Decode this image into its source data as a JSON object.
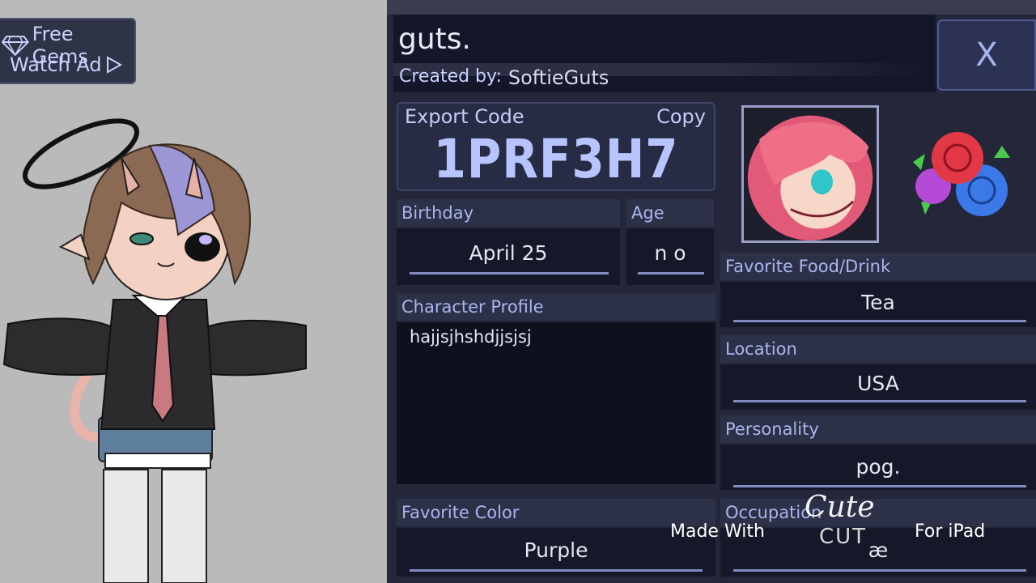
{
  "ad": {
    "free_gems": "Free Gems",
    "watch_ad": "Watch Ad"
  },
  "profile": {
    "name": "guts.",
    "created_by_label": "Created by:",
    "creator": "SoftieGuts",
    "close": "X",
    "export_label": "Export Code",
    "copy_label": "Copy",
    "export_code": "1PRF3H7",
    "birthday_label": "Birthday",
    "birthday": "April 25",
    "age_label": "Age",
    "age": "n o",
    "character_profile_label": "Character Profile",
    "character_profile": "hajjsjhshdjjsjsj",
    "favorite_color_label": "Favorite Color",
    "favorite_color": "Purple",
    "favorite_food_label": "Favorite Food/Drink",
    "favorite_food": "Tea",
    "location_label": "Location",
    "location": "USA",
    "personality_label": "Personality",
    "personality": "pog.",
    "occupation_label": "Occupation",
    "occupation": "æ"
  },
  "watermark": {
    "made_with": "Made With",
    "cute": "Cute",
    "cut": "CUT",
    "for_ipad": "For iPad"
  },
  "colors": {
    "panel_bg": "#232739",
    "header_bg": "#2d3147",
    "accent_text": "#a9b6f0",
    "stage_bg": "#bababa"
  }
}
